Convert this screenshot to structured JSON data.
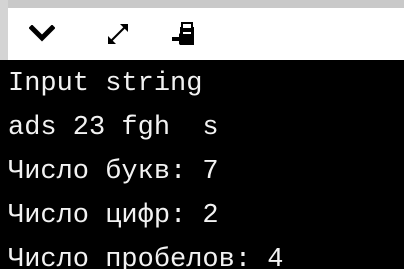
{
  "toolbar": {
    "buttons": [
      {
        "icon": "chevron-down-icon"
      },
      {
        "icon": "expand-icon"
      },
      {
        "icon": "clipboard-paste-icon"
      }
    ]
  },
  "console": {
    "lines": [
      "Input string",
      "ads 23 fgh  s",
      "Число букв: 7",
      "Число цифр: 2",
      "Число пробелов: 4"
    ]
  },
  "colors": {
    "console_background": "#000000",
    "console_text": "#f2f2f2",
    "toolbar_background": "#ffffff"
  }
}
